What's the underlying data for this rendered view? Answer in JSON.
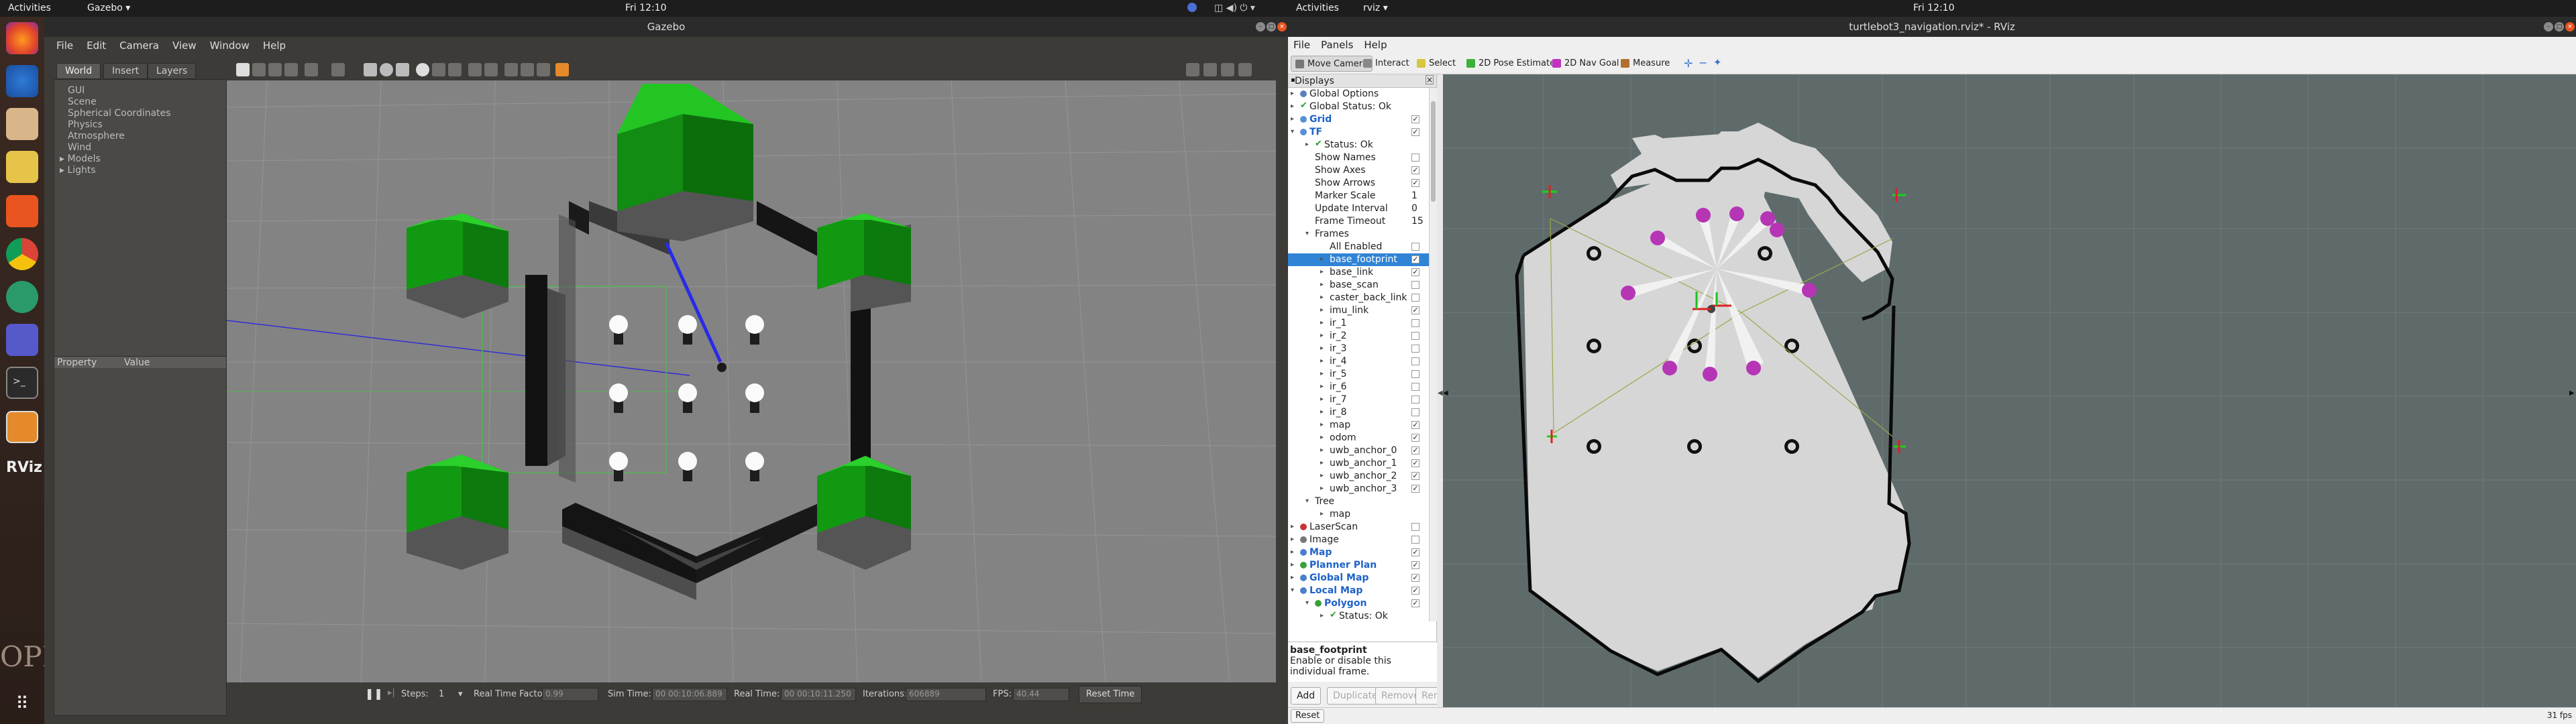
{
  "left_topbar": {
    "activities": "Activities",
    "app": "Gazebo ▾",
    "clock": "Fri 12:10"
  },
  "right_topbar": {
    "activities": "Activities",
    "app": "rviz ▾",
    "clock": "Fri 12:10"
  },
  "dock": {
    "items": [
      "firefox-icon",
      "thunderbird-icon",
      "files-icon",
      "rhythmbox-icon",
      "software-center-icon",
      "chrome-icon",
      "update-icon",
      "teams-icon",
      "terminal-icon",
      "gazebo-icon",
      "rviz-icon"
    ],
    "rviz_label": "RViz",
    "show_apps": "show-applications-icon",
    "watermark": "OPLE"
  },
  "gazebo": {
    "title": "Gazebo",
    "menu": [
      "File",
      "Edit",
      "Camera",
      "View",
      "Window",
      "Help"
    ],
    "tabs": [
      "World",
      "Insert",
      "Layers"
    ],
    "tree": [
      "GUI",
      "Scene",
      "Spherical Coordinates",
      "Physics",
      "Atmosphere",
      "Wind",
      "Models",
      "Lights"
    ],
    "prop_header": {
      "property": "Property",
      "value": "Value"
    },
    "status": {
      "steps_label": "Steps:",
      "steps_value": "1",
      "rtf_label": "Real Time Factor:",
      "rtf_value": "0.99",
      "sim_label": "Sim Time:",
      "sim_value": "00 00:10:06.889",
      "real_label": "Real Time:",
      "real_value": "00 00:10:11.250",
      "iter_label": "Iterations:",
      "iter_value": "606889",
      "fps_label": "FPS:",
      "fps_value": "40.44",
      "reset": "Reset Time"
    }
  },
  "rviz": {
    "title": "turtlebot3_navigation.rviz* - RViz",
    "menu": [
      "File",
      "Panels",
      "Help"
    ],
    "tools": [
      {
        "label": "Move Camera",
        "color": "#777777"
      },
      {
        "label": "Interact",
        "color": "#888888"
      },
      {
        "label": "Select",
        "color": "#d7c640"
      },
      {
        "label": "2D Pose Estimate",
        "color": "#3bb03b"
      },
      {
        "label": "2D Nav Goal",
        "color": "#c034c0"
      },
      {
        "label": "Measure",
        "color": "#b07030"
      }
    ],
    "displays_header": "Displays",
    "rows": [
      {
        "t": "Global Options",
        "d": 0,
        "a": "▸",
        "icon": "#5a7fbf",
        "type": "none"
      },
      {
        "t": "Global Status: Ok",
        "d": 0,
        "a": "▸",
        "icon": "check",
        "type": "none"
      },
      {
        "t": "Grid",
        "d": 0,
        "a": "▸",
        "icon": "#5a8fd6",
        "type": "cb",
        "c": true,
        "blue": true
      },
      {
        "t": "TF",
        "d": 0,
        "a": "▾",
        "icon": "#5a8fd6",
        "type": "cb",
        "c": true,
        "blue": true
      },
      {
        "t": "Status: Ok",
        "d": 1,
        "a": "▸",
        "icon": "check",
        "type": "none"
      },
      {
        "t": "Show Names",
        "d": 1,
        "type": "cb",
        "c": false
      },
      {
        "t": "Show Axes",
        "d": 1,
        "type": "cb",
        "c": true
      },
      {
        "t": "Show Arrows",
        "d": 1,
        "type": "cb",
        "c": true
      },
      {
        "t": "Marker Scale",
        "d": 1,
        "type": "val",
        "v": "1"
      },
      {
        "t": "Update Interval",
        "d": 1,
        "type": "val",
        "v": "0"
      },
      {
        "t": "Frame Timeout",
        "d": 1,
        "type": "val",
        "v": "15"
      },
      {
        "t": "Frames",
        "d": 1,
        "a": "▾",
        "type": "none"
      },
      {
        "t": "All Enabled",
        "d": 2,
        "type": "cb",
        "c": false
      },
      {
        "t": "base_footprint",
        "d": 2,
        "a": "▸",
        "type": "cb",
        "c": true,
        "sel": true
      },
      {
        "t": "base_link",
        "d": 2,
        "a": "▸",
        "type": "cb",
        "c": true
      },
      {
        "t": "base_scan",
        "d": 2,
        "a": "▸",
        "type": "cb",
        "c": false
      },
      {
        "t": "caster_back_link",
        "d": 2,
        "a": "▸",
        "type": "cb",
        "c": false
      },
      {
        "t": "imu_link",
        "d": 2,
        "a": "▸",
        "type": "cb",
        "c": true
      },
      {
        "t": "ir_1",
        "d": 2,
        "a": "▸",
        "type": "cb",
        "c": false
      },
      {
        "t": "ir_2",
        "d": 2,
        "a": "▸",
        "type": "cb",
        "c": false
      },
      {
        "t": "ir_3",
        "d": 2,
        "a": "▸",
        "type": "cb",
        "c": false
      },
      {
        "t": "ir_4",
        "d": 2,
        "a": "▸",
        "type": "cb",
        "c": false
      },
      {
        "t": "ir_5",
        "d": 2,
        "a": "▸",
        "type": "cb",
        "c": false
      },
      {
        "t": "ir_6",
        "d": 2,
        "a": "▸",
        "type": "cb",
        "c": false
      },
      {
        "t": "ir_7",
        "d": 2,
        "a": "▸",
        "type": "cb",
        "c": false
      },
      {
        "t": "ir_8",
        "d": 2,
        "a": "▸",
        "type": "cb",
        "c": false
      },
      {
        "t": "map",
        "d": 2,
        "a": "▸",
        "type": "cb",
        "c": true
      },
      {
        "t": "odom",
        "d": 2,
        "a": "▸",
        "type": "cb",
        "c": true
      },
      {
        "t": "uwb_anchor_0",
        "d": 2,
        "a": "▸",
        "type": "cb",
        "c": true
      },
      {
        "t": "uwb_anchor_1",
        "d": 2,
        "a": "▸",
        "type": "cb",
        "c": true
      },
      {
        "t": "uwb_anchor_2",
        "d": 2,
        "a": "▸",
        "type": "cb",
        "c": true
      },
      {
        "t": "uwb_anchor_3",
        "d": 2,
        "a": "▸",
        "type": "cb",
        "c": true
      },
      {
        "t": "Tree",
        "d": 1,
        "a": "▾",
        "type": "none"
      },
      {
        "t": "map",
        "d": 2,
        "a": "▸",
        "type": "none"
      },
      {
        "t": "LaserScan",
        "d": 0,
        "a": "▸",
        "icon": "#cc3333",
        "type": "cb",
        "c": false
      },
      {
        "t": "Image",
        "d": 0,
        "a": "▸",
        "icon": "#777777",
        "type": "cb",
        "c": false
      },
      {
        "t": "Map",
        "d": 0,
        "a": "▸",
        "icon": "#4a7fcf",
        "type": "cb",
        "c": true,
        "blue": true
      },
      {
        "t": "Planner Plan",
        "d": 0,
        "a": "▸",
        "icon": "#3aa03a",
        "type": "cb",
        "c": true,
        "blue": true
      },
      {
        "t": "Global Map",
        "d": 0,
        "a": "▸",
        "icon": "#4a7fcf",
        "type": "cb",
        "c": true,
        "blue": true
      },
      {
        "t": "Local Map",
        "d": 0,
        "a": "▾",
        "icon": "#4a7fcf",
        "type": "cb",
        "c": true,
        "blue": true
      },
      {
        "t": "Polygon",
        "d": 1,
        "a": "▾",
        "icon": "#3aa03a",
        "type": "cb",
        "c": true,
        "blue": true
      },
      {
        "t": "Status: Ok",
        "d": 2,
        "a": "▸",
        "icon": "check",
        "type": "none"
      }
    ],
    "desc_title": "base_footprint",
    "desc_text": "Enable or disable this individual frame.",
    "buttons": [
      "Add",
      "Duplicate",
      "Remove",
      "Rename"
    ],
    "reset": "Reset",
    "fps": "31 fps"
  }
}
